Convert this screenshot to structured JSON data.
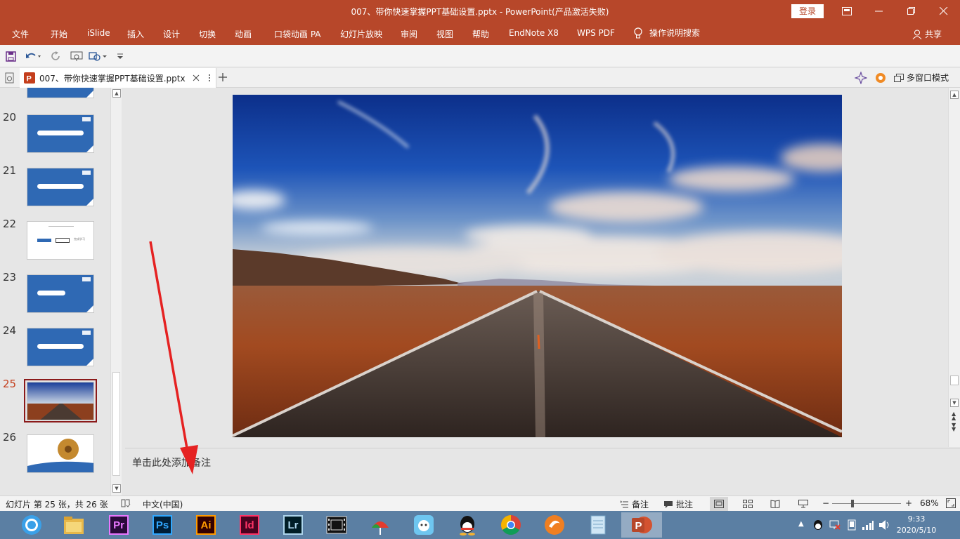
{
  "window": {
    "title": "007、带你快速掌握PPT基础设置.pptx  -  PowerPoint(产品激活失败)",
    "login_label": "登录"
  },
  "ribbon": {
    "tabs": [
      "文件",
      "开始",
      "iSlide",
      "插入",
      "设计",
      "切换",
      "动画",
      "口袋动画 PA",
      "幻灯片放映",
      "审阅",
      "视图",
      "帮助",
      "EndNote X8",
      "WPS PDF"
    ],
    "search_label": "操作说明搜索",
    "share_label": "共享"
  },
  "document_tab": {
    "label": "007、带你快速掌握PPT基础设置.pptx",
    "multi_window_label": "多窗口模式"
  },
  "thumbnails": {
    "items": [
      {
        "number": "20",
        "style": "blue"
      },
      {
        "number": "21",
        "style": "blue"
      },
      {
        "number": "22",
        "style": "white"
      },
      {
        "number": "23",
        "style": "blue"
      },
      {
        "number": "24",
        "style": "blue"
      },
      {
        "number": "25",
        "style": "photo",
        "selected": true
      },
      {
        "number": "26",
        "style": "circle"
      }
    ],
    "thumb22_button_label": "完成学习"
  },
  "notes": {
    "placeholder": "单击此处添加备注"
  },
  "statusbar": {
    "slide_info": "幻灯片 第 25 张，共 26 张",
    "language": "中文(中国)",
    "notes_label": "备注",
    "comments_label": "批注",
    "zoom_level": "68%",
    "zoom_fraction": 0.3
  },
  "taskbar": {
    "apps": [
      {
        "name": "browser",
        "label": ""
      },
      {
        "name": "file-explorer",
        "label": ""
      },
      {
        "name": "premiere",
        "label": "Pr",
        "color": "#ea77ff",
        "bg": "#2a0a3a"
      },
      {
        "name": "photoshop",
        "label": "Ps",
        "color": "#31a8ff",
        "bg": "#001e36"
      },
      {
        "name": "illustrator",
        "label": "Ai",
        "color": "#ff9a00",
        "bg": "#330000"
      },
      {
        "name": "indesign",
        "label": "Id",
        "color": "#ff3366",
        "bg": "#49021f"
      },
      {
        "name": "lightroom",
        "label": "Lr",
        "color": "#add5ec",
        "bg": "#001d26"
      },
      {
        "name": "video-editor",
        "label": ""
      },
      {
        "name": "app-umbrella",
        "label": ""
      },
      {
        "name": "app-assistant",
        "label": ""
      },
      {
        "name": "qq",
        "label": ""
      },
      {
        "name": "chrome",
        "label": ""
      },
      {
        "name": "app-orange",
        "label": ""
      },
      {
        "name": "notes-app",
        "label": ""
      },
      {
        "name": "powerpoint",
        "label": "P",
        "active": true
      }
    ],
    "clock_time": "9:33",
    "clock_date": "2020/5/10"
  },
  "colors": {
    "accent": "#b7472a",
    "selected_border": "#8b1a1a",
    "annotation": "#e52222"
  }
}
